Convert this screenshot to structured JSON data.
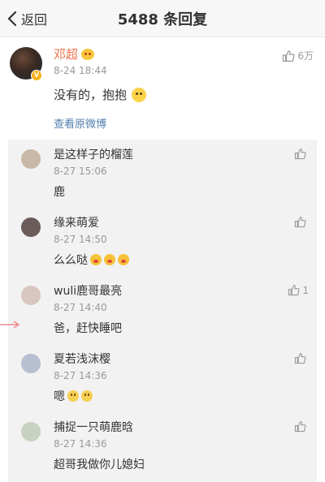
{
  "nav": {
    "back_label": "返回",
    "title": "5488 条回复"
  },
  "post": {
    "author": "邓超",
    "time": "8-24 18:44",
    "likes": "6万",
    "text": "没有的，抱抱",
    "view_original": "查看原微博",
    "emoji": "hug-emoji"
  },
  "replies": [
    {
      "name": "是这样子的榴莲",
      "time": "8-27 15:06",
      "text": "鹿",
      "likes": "",
      "emojis": [],
      "avatar_color": "#c9b8a8"
    },
    {
      "name": "缘来萌爱",
      "time": "8-27 14:50",
      "text": "么么哒",
      "likes": "",
      "emojis": [
        "kiss",
        "kiss",
        "kiss"
      ],
      "avatar_color": "#6b5b5b"
    },
    {
      "name": "wuli鹿哥最亮",
      "time": "8-27 14:40",
      "text": "爸，赶快睡吧",
      "likes": "1",
      "emojis": [],
      "avatar_color": "#d8c6c0"
    },
    {
      "name": "夏若浅沫樱",
      "time": "8-27 14:36",
      "text": "嗯",
      "likes": "",
      "emojis": [
        "smile",
        "smile"
      ],
      "avatar_color": "#b7bfd0"
    },
    {
      "name": "捕捉一只萌鹿晗",
      "time": "8-27 14:36",
      "text": "超哥我做你儿媳妇",
      "likes": "",
      "emojis": [],
      "avatar_color": "#c8d2c0"
    }
  ],
  "colors": {
    "accent_name": "#eb7350",
    "link": "#507daf",
    "pointer": "#f08a8a"
  }
}
